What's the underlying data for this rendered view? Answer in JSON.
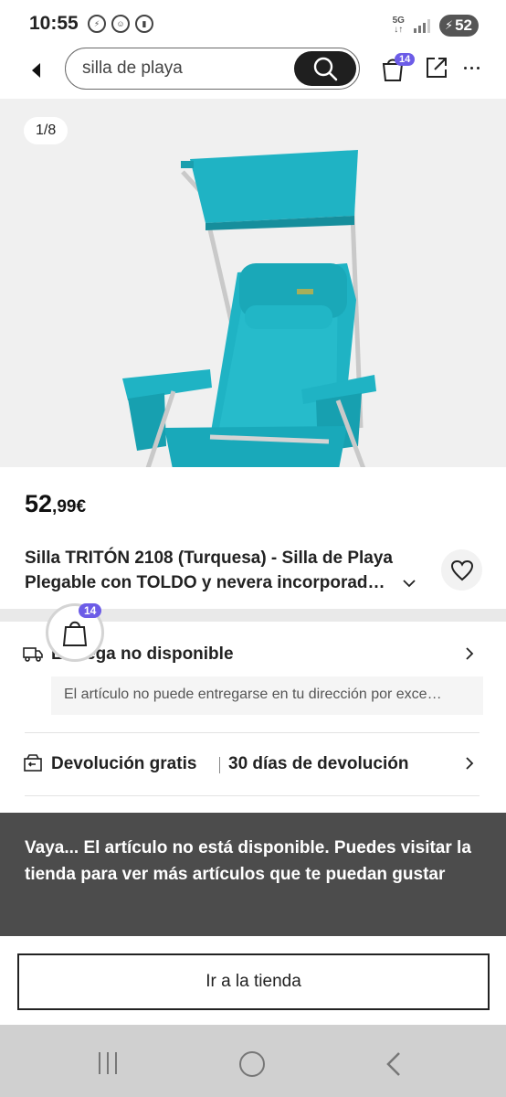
{
  "status_bar": {
    "time": "10:55",
    "network": "5G",
    "battery": "52"
  },
  "header": {
    "search_value": "silla de playa",
    "cart_count": "14"
  },
  "gallery": {
    "counter": "1/8"
  },
  "product": {
    "price_int": "52",
    "price_dec": ",99€",
    "title": "Silla TRITÓN 2108 (Turquesa) - Silla de Playa Plegable con TOLDO y nevera incorporad…"
  },
  "floating_bag": {
    "count": "14"
  },
  "delivery": {
    "label": "Entrega no disponible",
    "note": "El artículo no puede entregarse en tu dirección por exce…"
  },
  "returns": {
    "label": "Devolución gratis",
    "days": "30 días de devolución"
  },
  "banner": {
    "text": "Vaya... El artículo no está disponible. Puedes visitar la tienda para ver más artículos que te puedan gustar"
  },
  "store_button": {
    "label": "Ir a la tienda"
  },
  "colors": {
    "badge": "#6c5ce7",
    "banner_bg": "#4c4c4c",
    "product_teal": "#1fb3c4"
  }
}
